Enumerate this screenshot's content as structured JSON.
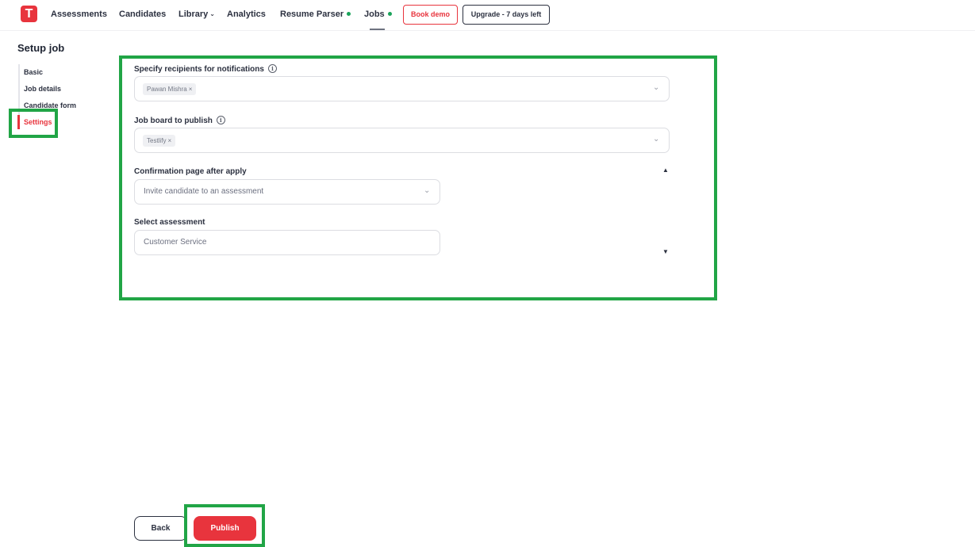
{
  "app": {
    "logo_letter": "T"
  },
  "nav": {
    "assessments": "Assessments",
    "candidates": "Candidates",
    "library": "Library",
    "analytics": "Analytics",
    "resume_parser": "Resume Parser",
    "jobs": "Jobs",
    "book_demo": "Book demo",
    "upgrade": "Upgrade - 7 days left",
    "status_dot_color": "#1aa35a"
  },
  "sidebar": {
    "title": "Setup job",
    "items": [
      {
        "label": "Basic"
      },
      {
        "label": "Job details"
      },
      {
        "label": "Candidate form"
      },
      {
        "label": "Settings",
        "active": true
      }
    ]
  },
  "form": {
    "recipients": {
      "label": "Specify recipients for notifications",
      "chips": [
        "Pawan Mishra"
      ]
    },
    "job_board": {
      "label": "Job board to publish",
      "chips": [
        "Testlify"
      ]
    },
    "confirmation": {
      "label": "Confirmation page after apply",
      "value": "Invite candidate to an assessment"
    },
    "assessment": {
      "label": "Select assessment",
      "value": "Customer Service"
    }
  },
  "footer": {
    "back": "Back",
    "publish": "Publish"
  },
  "colors": {
    "accent": "#e8343d",
    "highlight": "#21a546"
  }
}
